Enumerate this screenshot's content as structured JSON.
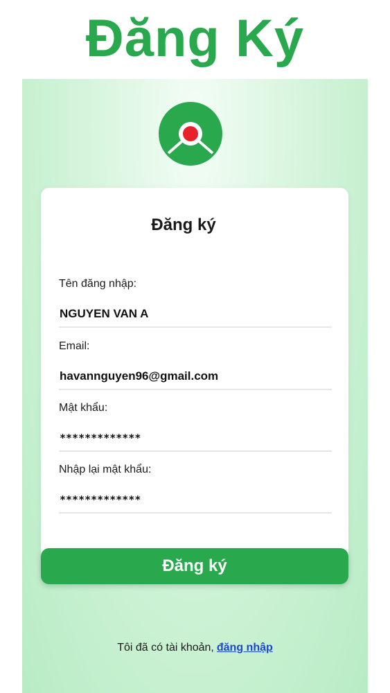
{
  "page": {
    "heading": "Đăng Ký"
  },
  "colors": {
    "brand_green": "#2aa84e",
    "logo_red": "#e8202a",
    "link_blue": "#1a47d6"
  },
  "logo": {
    "icon": "brand-logo-icon"
  },
  "form": {
    "title": "Đăng ký",
    "fields": [
      {
        "label": "Tên đăng nhập:",
        "value": "NGUYEN VAN A"
      },
      {
        "label": "Email:",
        "value": "havannguyen96@gmail.com"
      },
      {
        "label": "Mật khẩu:",
        "value": "*************"
      },
      {
        "label": "Nhập lại mật khẩu:",
        "value": "*************"
      }
    ],
    "submit_label": "Đăng ký"
  },
  "footer": {
    "text": "Tôi đã có tài khoản,",
    "link_label": "đăng nhập"
  }
}
